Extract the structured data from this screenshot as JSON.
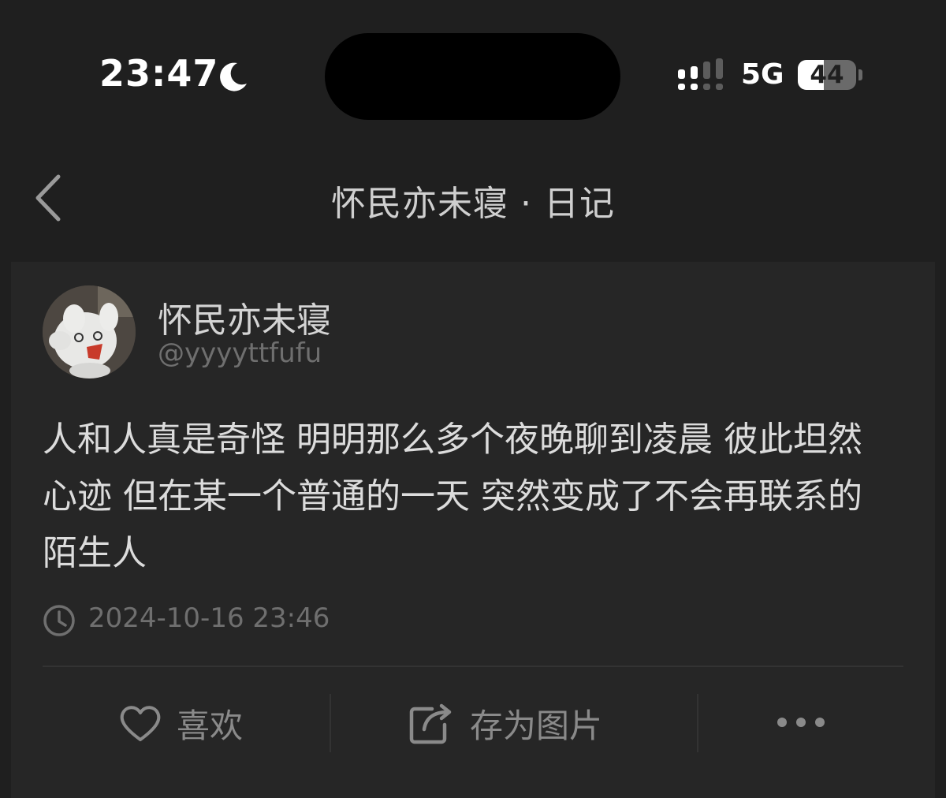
{
  "status_bar": {
    "time": "23:47",
    "network": "5G",
    "battery": "44",
    "battery_level": 0.44,
    "focus_icon": "moon-icon",
    "signal_icon": "cellular-signal-icon"
  },
  "nav": {
    "back_icon": "chevron-left-icon",
    "title": "怀民亦未寝 · 日记"
  },
  "post": {
    "author_name": "怀民亦未寝",
    "author_handle": "@yyyyttfufu",
    "body": "人和人真是奇怪 明明那么多个夜晚聊到凌晨 彼此坦然心迹 但在某一个普通的一天 突然变成了不会再联系的陌生人",
    "timestamp": "2024-10-16 23:46",
    "clock_icon": "clock-icon"
  },
  "actions": {
    "like_label": "喜欢",
    "like_icon": "heart-icon",
    "save_image_label": "存为图片",
    "save_image_icon": "share-export-icon",
    "more_icon": "more-dots-icon"
  },
  "colors": {
    "background": "#1f1f1f",
    "card": "#262626",
    "muted_text": "#6f6f6f",
    "body_text": "#dcdcdc"
  }
}
